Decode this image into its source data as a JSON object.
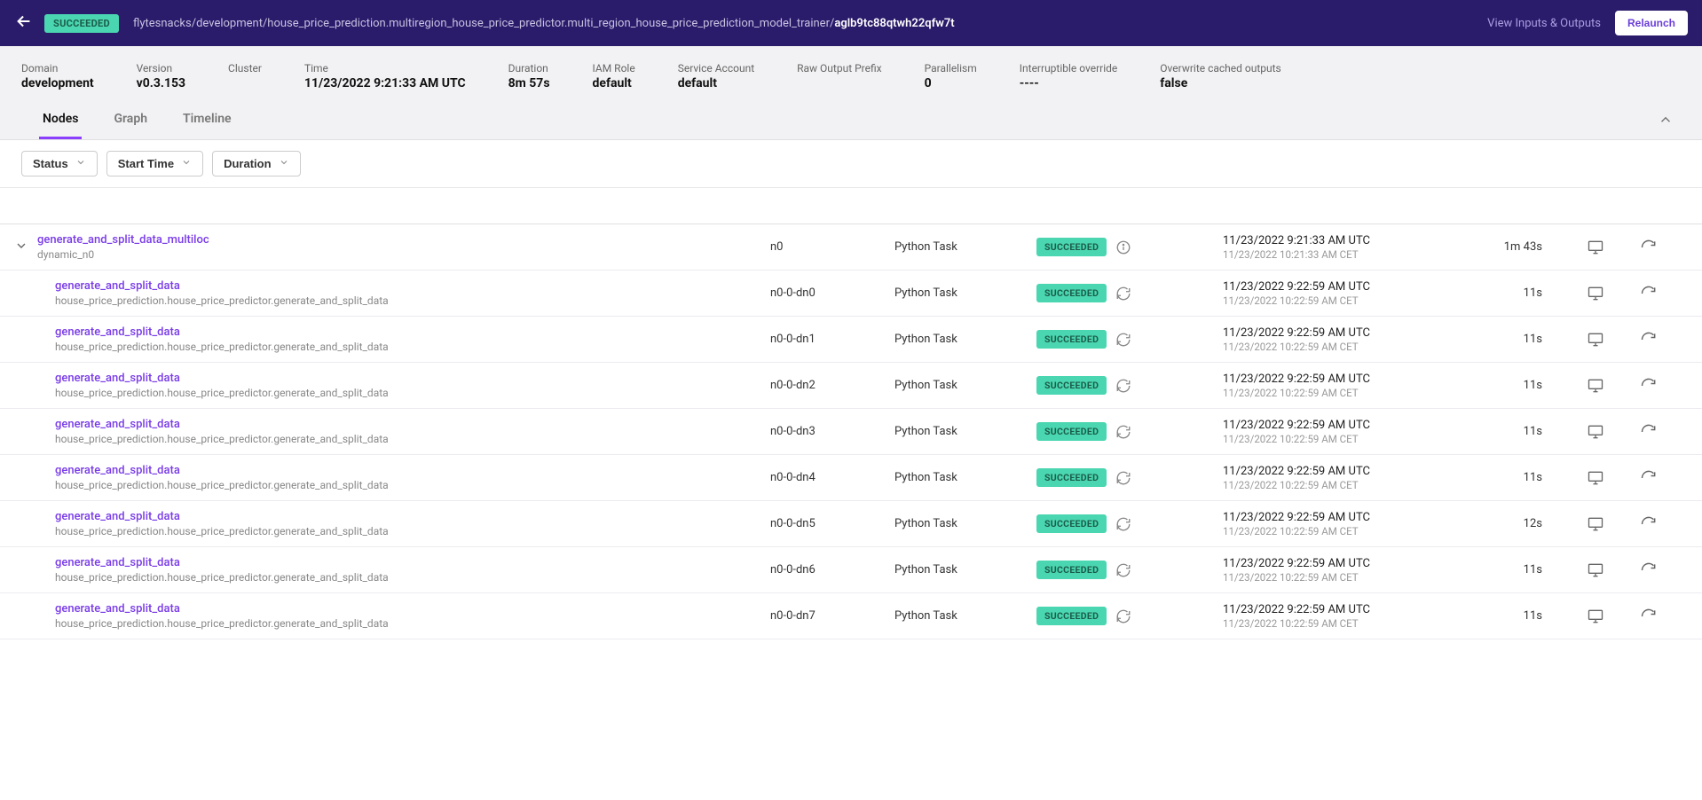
{
  "topbar": {
    "status": "SUCCEEDED",
    "breadcrumb_prefix": "flytesnacks/development/house_price_prediction.multiregion_house_price_predictor.multi_region_house_price_prediction_model_trainer/",
    "exec_id": "aglb9tc88qtwh22qfw7t",
    "view_io": "View Inputs & Outputs",
    "relaunch": "Relaunch"
  },
  "meta": {
    "items": [
      {
        "label": "Domain",
        "value": "development"
      },
      {
        "label": "Version",
        "value": "v0.3.153"
      },
      {
        "label": "Cluster",
        "value": ""
      },
      {
        "label": "Time",
        "value": "11/23/2022 9:21:33 AM UTC"
      },
      {
        "label": "Duration",
        "value": "8m 57s"
      },
      {
        "label": "IAM Role",
        "value": "default"
      },
      {
        "label": "Service Account",
        "value": "default"
      },
      {
        "label": "Raw Output Prefix",
        "value": ""
      },
      {
        "label": "Parallelism",
        "value": "0"
      },
      {
        "label": "Interruptible override",
        "value": "----"
      },
      {
        "label": "Overwrite cached outputs",
        "value": "false"
      }
    ]
  },
  "tabs": {
    "items": [
      "Nodes",
      "Graph",
      "Timeline"
    ],
    "active": 0
  },
  "filters": {
    "status": "Status",
    "start_time": "Start Time",
    "duration": "Duration"
  },
  "nodes": [
    {
      "child": false,
      "expandable": true,
      "name": "generate_and_split_data_multiloc",
      "sub": "dynamic_n0",
      "id": "n0",
      "type": "Python Task",
      "status": "SUCCEEDED",
      "icon": "info",
      "time_utc": "11/23/2022 9:21:33 AM UTC",
      "time_local": "11/23/2022 10:21:33 AM CET",
      "duration": "1m 43s"
    },
    {
      "child": true,
      "name": "generate_and_split_data",
      "sub": "house_price_prediction.house_price_predictor.generate_and_split_data",
      "id": "n0-0-dn0",
      "type": "Python Task",
      "status": "SUCCEEDED",
      "icon": "cache",
      "time_utc": "11/23/2022 9:22:59 AM UTC",
      "time_local": "11/23/2022 10:22:59 AM CET",
      "duration": "11s"
    },
    {
      "child": true,
      "name": "generate_and_split_data",
      "sub": "house_price_prediction.house_price_predictor.generate_and_split_data",
      "id": "n0-0-dn1",
      "type": "Python Task",
      "status": "SUCCEEDED",
      "icon": "cache",
      "time_utc": "11/23/2022 9:22:59 AM UTC",
      "time_local": "11/23/2022 10:22:59 AM CET",
      "duration": "11s"
    },
    {
      "child": true,
      "name": "generate_and_split_data",
      "sub": "house_price_prediction.house_price_predictor.generate_and_split_data",
      "id": "n0-0-dn2",
      "type": "Python Task",
      "status": "SUCCEEDED",
      "icon": "cache",
      "time_utc": "11/23/2022 9:22:59 AM UTC",
      "time_local": "11/23/2022 10:22:59 AM CET",
      "duration": "11s"
    },
    {
      "child": true,
      "name": "generate_and_split_data",
      "sub": "house_price_prediction.house_price_predictor.generate_and_split_data",
      "id": "n0-0-dn3",
      "type": "Python Task",
      "status": "SUCCEEDED",
      "icon": "cache",
      "time_utc": "11/23/2022 9:22:59 AM UTC",
      "time_local": "11/23/2022 10:22:59 AM CET",
      "duration": "11s"
    },
    {
      "child": true,
      "name": "generate_and_split_data",
      "sub": "house_price_prediction.house_price_predictor.generate_and_split_data",
      "id": "n0-0-dn4",
      "type": "Python Task",
      "status": "SUCCEEDED",
      "icon": "cache",
      "time_utc": "11/23/2022 9:22:59 AM UTC",
      "time_local": "11/23/2022 10:22:59 AM CET",
      "duration": "11s"
    },
    {
      "child": true,
      "name": "generate_and_split_data",
      "sub": "house_price_prediction.house_price_predictor.generate_and_split_data",
      "id": "n0-0-dn5",
      "type": "Python Task",
      "status": "SUCCEEDED",
      "icon": "cache",
      "time_utc": "11/23/2022 9:22:59 AM UTC",
      "time_local": "11/23/2022 10:22:59 AM CET",
      "duration": "12s"
    },
    {
      "child": true,
      "name": "generate_and_split_data",
      "sub": "house_price_prediction.house_price_predictor.generate_and_split_data",
      "id": "n0-0-dn6",
      "type": "Python Task",
      "status": "SUCCEEDED",
      "icon": "cache",
      "time_utc": "11/23/2022 9:22:59 AM UTC",
      "time_local": "11/23/2022 10:22:59 AM CET",
      "duration": "11s"
    },
    {
      "child": true,
      "name": "generate_and_split_data",
      "sub": "house_price_prediction.house_price_predictor.generate_and_split_data",
      "id": "n0-0-dn7",
      "type": "Python Task",
      "status": "SUCCEEDED",
      "icon": "cache",
      "time_utc": "11/23/2022 9:22:59 AM UTC",
      "time_local": "11/23/2022 10:22:59 AM CET",
      "duration": "11s"
    }
  ]
}
